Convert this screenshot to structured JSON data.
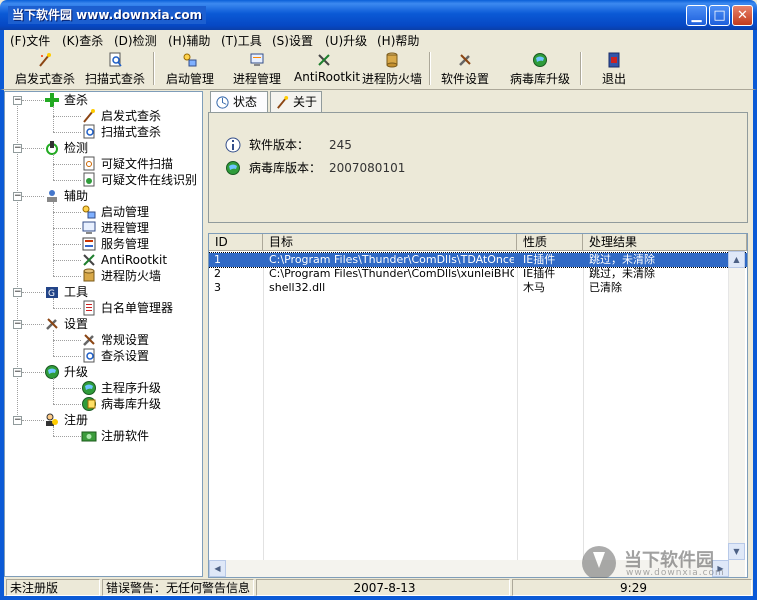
{
  "window": {
    "title": "当下软件园 www.downxia.com"
  },
  "menu": [
    {
      "label": "(F)文件"
    },
    {
      "label": "(K)查杀"
    },
    {
      "label": "(D)检测"
    },
    {
      "label": "(H)辅助"
    },
    {
      "label": "(T)工具"
    },
    {
      "label": "(S)设置"
    },
    {
      "label": "(U)升级"
    },
    {
      "label": "(H)帮助"
    }
  ],
  "toolbar": [
    {
      "label": "启发式查杀",
      "icon": "magic-wand-icon"
    },
    {
      "label": "扫描式查杀",
      "icon": "scan-icon"
    },
    {
      "label": "启动管理",
      "icon": "startup-icon"
    },
    {
      "label": "进程管理",
      "icon": "process-icon"
    },
    {
      "label": "AntiRootkit",
      "icon": "antirootkit-icon"
    },
    {
      "label": "进程防火墙",
      "icon": "firewall-icon"
    },
    {
      "label": "软件设置",
      "icon": "tools-icon"
    },
    {
      "label": "病毒库升级",
      "icon": "globe-icon"
    },
    {
      "label": "退出",
      "icon": "exit-icon"
    }
  ],
  "tree": {
    "groups": [
      {
        "label": "查杀",
        "children": [
          "启发式查杀",
          "扫描式查杀"
        ]
      },
      {
        "label": "检测",
        "children": [
          "可疑文件扫描",
          "可疑文件在线识别"
        ]
      },
      {
        "label": "辅助",
        "children": [
          "启动管理",
          "进程管理",
          "服务管理",
          "AntiRootkit",
          "进程防火墙"
        ]
      },
      {
        "label": "工具",
        "children": [
          "白名单管理器"
        ]
      },
      {
        "label": "设置",
        "children": [
          "常规设置",
          "查杀设置"
        ]
      },
      {
        "label": "升级",
        "children": [
          "主程序升级",
          "病毒库升级"
        ]
      },
      {
        "label": "注册",
        "children": [
          "注册软件"
        ]
      }
    ]
  },
  "tabs": [
    {
      "label": "状态"
    },
    {
      "label": "关于"
    }
  ],
  "status": {
    "version_label": "软件版本：",
    "version_value": "245",
    "db_label": "病毒库版本：",
    "db_value": "2007080101"
  },
  "table": {
    "columns": [
      "ID",
      "目标",
      "性质",
      "处理结果"
    ],
    "rows": [
      [
        "1",
        "C:\\Program Files\\Thunder\\ComDlls\\TDAtOnce...",
        "IE插件",
        "跳过，未清除"
      ],
      [
        "2",
        "C:\\Program Files\\Thunder\\ComDlls\\xunleiBHO_...",
        "IE插件",
        "跳过，未清除"
      ],
      [
        "3",
        "shell32.dll",
        "木马",
        "已清除"
      ]
    ]
  },
  "watermark": {
    "brand": "当下软件园",
    "url": "www.downxia.com"
  },
  "statusbar": {
    "reg": "未注册版",
    "warning": "错误警告：无任何警告信息",
    "date": "2007-8-13",
    "time": "9:29"
  }
}
